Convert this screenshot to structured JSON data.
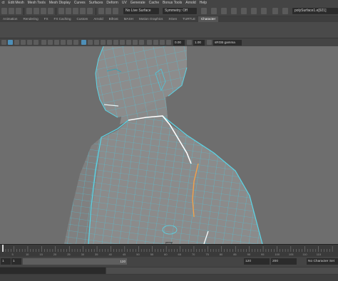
{
  "menubar": {
    "items": [
      "ct",
      "Edit Mesh",
      "Mesh Tools",
      "Mesh Display",
      "Curves",
      "Surfaces",
      "Deform",
      "UV",
      "Generate",
      "Cache",
      "Bonus Tools",
      "Arnold",
      "Help"
    ]
  },
  "statusline": {
    "live_surface": "No Live Surface",
    "symmetry": "Symmetry: Off",
    "object_name": "polySurface1.e[921]"
  },
  "shelf_tabs": {
    "items": [
      "Animation",
      "Rendering",
      "FX",
      "FX Caching",
      "Custom",
      "Arnold",
      "Bifrost",
      "MASH",
      "Motion Graphics",
      "XGen",
      "TURTLE",
      "Character"
    ],
    "active": "Character"
  },
  "panel_toolbar": {
    "value1": "0.00",
    "value2": "1.00",
    "color_space": "sRGB gamma"
  },
  "viewport": {
    "camera_label": "persp",
    "highlight_color": "#5ad6e8",
    "selected_edge_color": "#ffffff",
    "seam_color": "#f2a04a"
  },
  "timeslider": {
    "marks": [
      "5",
      "10",
      "15",
      "20",
      "25",
      "30",
      "35",
      "40",
      "45",
      "50",
      "55",
      "60",
      "65",
      "70",
      "75",
      "80",
      "85",
      "90",
      "95",
      "100",
      "105",
      "110",
      "115"
    ],
    "current_frame": "1"
  },
  "rangeslider": {
    "start": "1",
    "playback_start": "1",
    "playback_end": "120",
    "range_end": "120",
    "anim_end": "200",
    "character_set": "No Character Set"
  }
}
